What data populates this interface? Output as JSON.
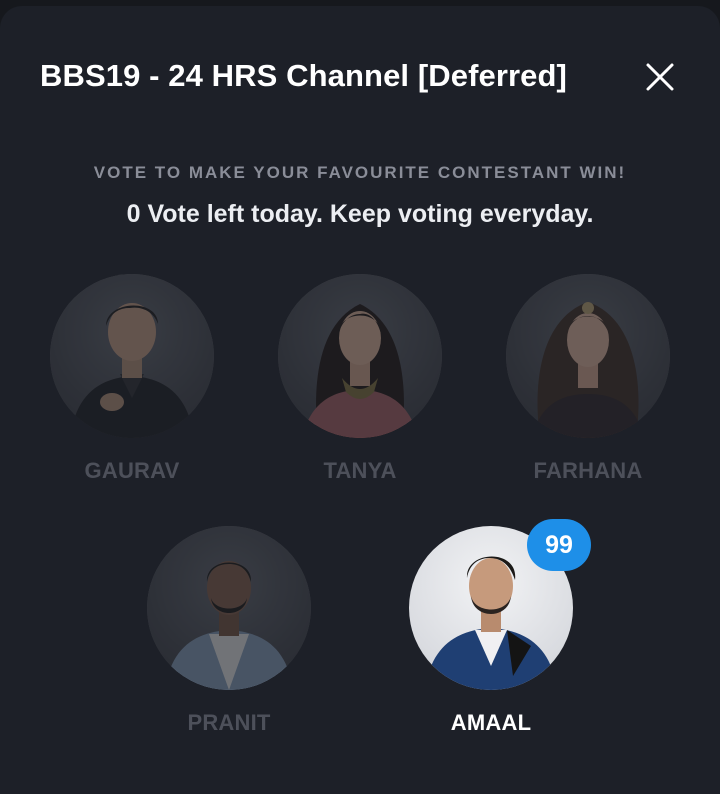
{
  "header": {
    "title": "BBS19 - 24 HRS Channel [Deferred]"
  },
  "subtitle": "VOTE TO MAKE YOUR FAVOURITE CONTESTANT WIN!",
  "vote_status": "0 Vote left today. Keep voting everyday.",
  "contestants": [
    {
      "name": "GAURAV",
      "active": false
    },
    {
      "name": "TANYA",
      "active": false
    },
    {
      "name": "FARHANA",
      "active": false
    },
    {
      "name": "PRANIT",
      "active": false
    },
    {
      "name": "AMAAL",
      "active": true,
      "badge": "99"
    }
  ],
  "colors": {
    "background": "#1d2028",
    "badge": "#1e8fe8",
    "inactive_name": "#4d505a",
    "active_name": "#ffffff"
  }
}
